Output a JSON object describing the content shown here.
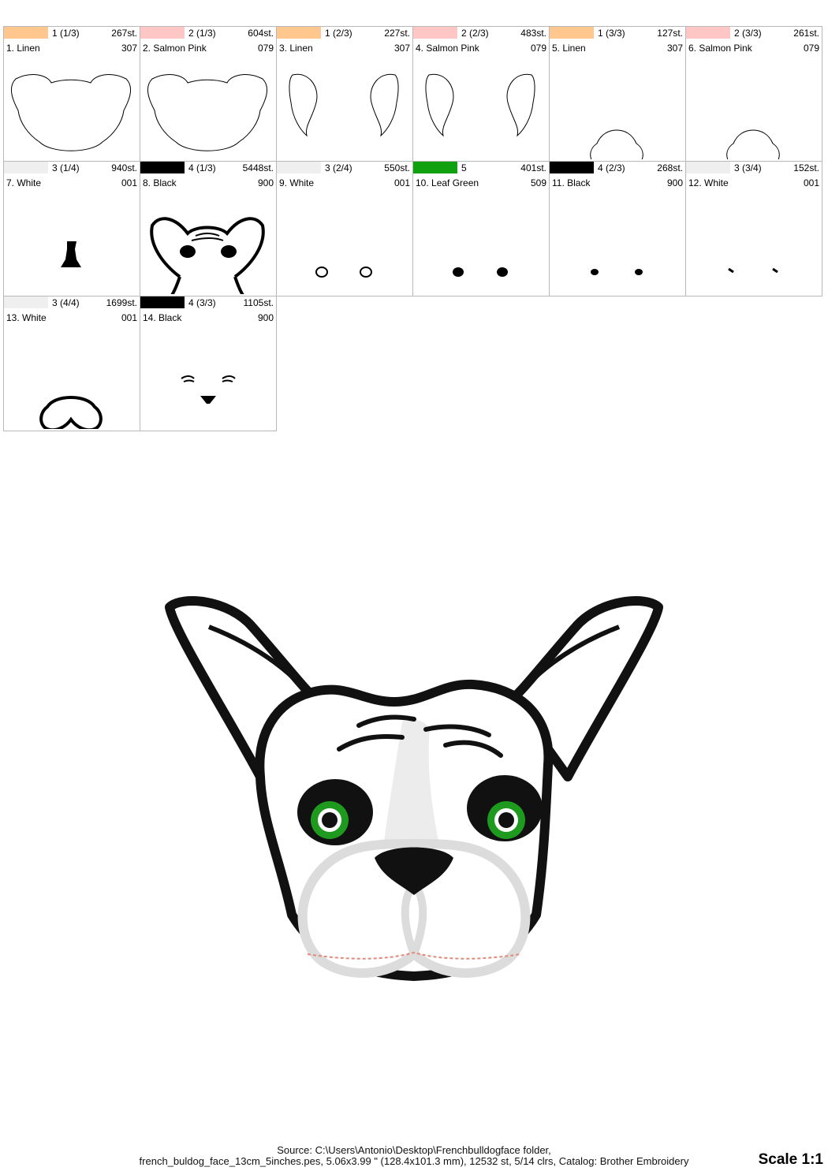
{
  "steps": [
    {
      "swatch": "#ffc78e",
      "step": "1 (1/3)",
      "stitches": "267st.",
      "name": "1. Linen",
      "code": "307",
      "icon": "head-outline-icon"
    },
    {
      "swatch": "#ffc6c6",
      "step": "2 (1/3)",
      "stitches": "604st.",
      "name": "2. Salmon Pink",
      "code": "079",
      "icon": "head-outline-icon"
    },
    {
      "swatch": "#ffc78e",
      "step": "1 (2/3)",
      "stitches": "227st.",
      "name": "3. Linen",
      "code": "307",
      "icon": "ears-outline-icon"
    },
    {
      "swatch": "#ffc6c6",
      "step": "2 (2/3)",
      "stitches": "483st.",
      "name": "4. Salmon Pink",
      "code": "079",
      "icon": "ears-outline-icon"
    },
    {
      "swatch": "#ffc78e",
      "step": "1 (3/3)",
      "stitches": "127st.",
      "name": "5. Linen",
      "code": "307",
      "icon": "muzzle-outline-icon"
    },
    {
      "swatch": "#ffc6c6",
      "step": "2 (3/3)",
      "stitches": "261st.",
      "name": "6. Salmon Pink",
      "code": "079",
      "icon": "muzzle-outline-icon"
    },
    {
      "swatch": "#efefef",
      "step": "3 (1/4)",
      "stitches": "940st.",
      "name": "7. White",
      "code": "001",
      "icon": "blaze-icon"
    },
    {
      "swatch": "#000000",
      "step": "4 (1/3)",
      "stitches": "5448st.",
      "name": "8. Black",
      "code": "900",
      "icon": "face-outline-icon"
    },
    {
      "swatch": "#efefef",
      "step": "3 (2/4)",
      "stitches": "550st.",
      "name": "9. White",
      "code": "001",
      "icon": "eye-rings-icon"
    },
    {
      "swatch": "#10a010",
      "step": "5",
      "stitches": "401st.",
      "name": "10. Leaf Green",
      "code": "509",
      "icon": "eye-dots-icon"
    },
    {
      "swatch": "#000000",
      "step": "4 (2/3)",
      "stitches": "268st.",
      "name": "11. Black",
      "code": "900",
      "icon": "pupils-icon"
    },
    {
      "swatch": "#efefef",
      "step": "3 (3/4)",
      "stitches": "152st.",
      "name": "12. White",
      "code": "001",
      "icon": "highlights-icon"
    },
    {
      "swatch": "#efefef",
      "step": "3 (4/4)",
      "stitches": "1699st.",
      "name": "13. White",
      "code": "001",
      "icon": "muzzle-satin-icon"
    },
    {
      "swatch": "#000000",
      "step": "4 (3/3)",
      "stitches": "1105st.",
      "name": "14. Black",
      "code": "900",
      "icon": "brows-nose-icon"
    }
  ],
  "footer": {
    "line1": "Source: C:\\Users\\Antonio\\Desktop\\Frenchbulldogface folder,",
    "line2": "french_buldog_face_13cm_5inches.pes, 5.06x3.99 \" (128.4x101.3 mm), 12532 st, 5/14 clrs, Catalog: Brother Embroidery"
  },
  "scale_label": "Scale 1:1",
  "colors": {
    "black": "#111111",
    "white": "#ffffff",
    "green": "#1e9a1e",
    "stitch_line": "#e08a7a"
  }
}
